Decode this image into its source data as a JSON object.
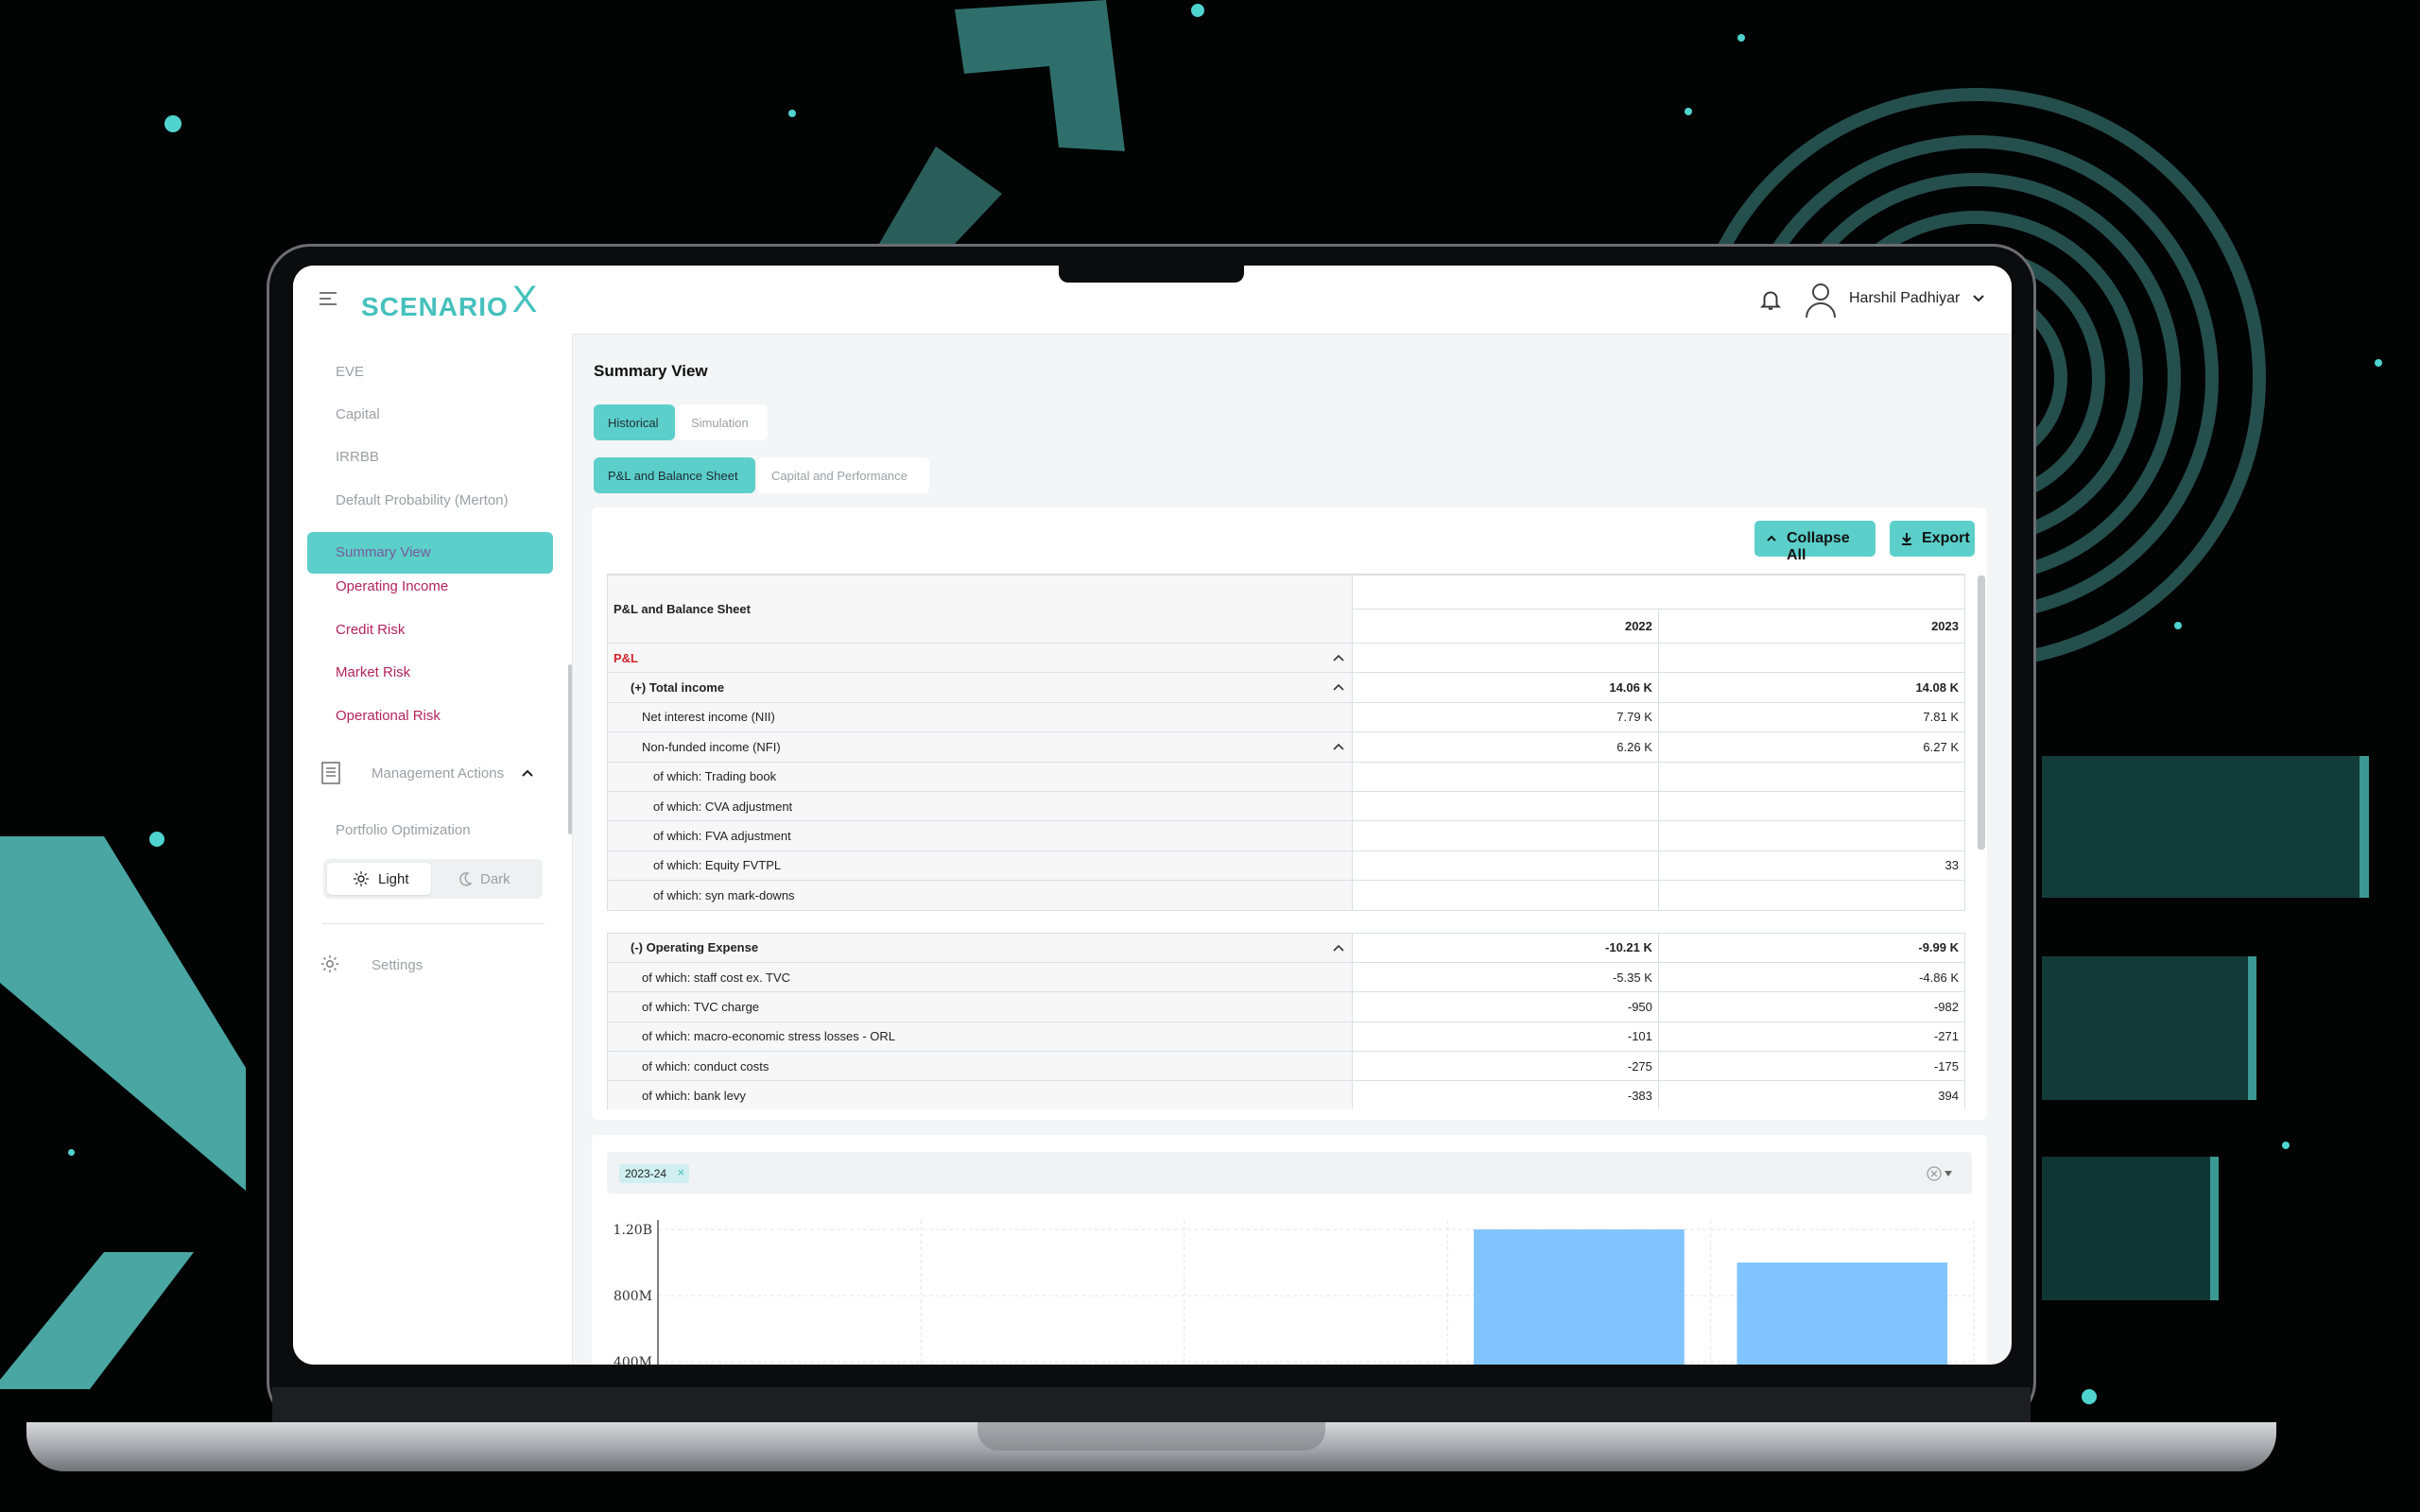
{
  "colors": {
    "accent": "#5ccfca",
    "pink": "#b3245c",
    "red": "#d2232a",
    "bar": "#82c4ff"
  },
  "app": {
    "logo": "SCENARIO",
    "logo_mark": "X",
    "user_name": "Harshil Padhiyar"
  },
  "sidebar": {
    "items": [
      {
        "label": "EVE"
      },
      {
        "label": "Capital"
      },
      {
        "label": "IRRBB"
      },
      {
        "label": "Default Probability (Merton)"
      },
      {
        "label": "Summary View",
        "active": true
      },
      {
        "label": "Operating Income"
      },
      {
        "label": "Credit Risk"
      },
      {
        "label": "Market Risk"
      },
      {
        "label": "Operational Risk"
      }
    ],
    "management_label": "Management Actions",
    "portfolio_label": "Portfolio Optimization",
    "theme_light": "Light",
    "theme_dark": "Dark",
    "settings_label": "Settings"
  },
  "main": {
    "title": "Summary View",
    "tabs": [
      "Historical",
      "Simulation"
    ],
    "subtabs": [
      "P&L and Balance Sheet",
      "Capital and Performance"
    ],
    "collapse_label": "Collapse All",
    "export_label": "Export"
  },
  "table": {
    "header": "P&L and Balance Sheet",
    "years": [
      "2022",
      "2023"
    ],
    "rows": [
      {
        "label": "P&L",
        "v2022": "",
        "v2023": ""
      },
      {
        "label": "(+) Total income",
        "v2022": "14.06 K",
        "v2023": "14.08 K"
      },
      {
        "label": "Net interest income (NII)",
        "v2022": "7.79 K",
        "v2023": "7.81 K"
      },
      {
        "label": "Non-funded income (NFI)",
        "v2022": "6.26 K",
        "v2023": "6.27 K"
      },
      {
        "label": "of which: Trading book",
        "v2022": "",
        "v2023": ""
      },
      {
        "label": "of which: CVA adjustment",
        "v2022": "",
        "v2023": ""
      },
      {
        "label": "of which: FVA adjustment",
        "v2022": "",
        "v2023": ""
      },
      {
        "label": "of which: Equity FVTPL",
        "v2022": "",
        "v2023": "33"
      },
      {
        "label": "of which: syn mark-downs",
        "v2022": "",
        "v2023": ""
      },
      {
        "label": "(-) Operating Expense",
        "v2022": "-10.21 K",
        "v2023": "-9.99 K"
      },
      {
        "label": "of which: staff cost ex. TVC",
        "v2022": "-5.35 K",
        "v2023": "-4.86 K"
      },
      {
        "label": "of which: TVC charge",
        "v2022": "-950",
        "v2023": "-982"
      },
      {
        "label": "of which: macro-economic stress losses - ORL",
        "v2022": "-101",
        "v2023": "-271"
      },
      {
        "label": "of which: conduct costs",
        "v2022": "-275",
        "v2023": "-175"
      },
      {
        "label": "of which: bank levy",
        "v2022": "-383",
        "v2023": "394"
      }
    ]
  },
  "filter": {
    "chip": "2023-24"
  },
  "chart_data": {
    "type": "bar",
    "ytick_labels": [
      "1.20B",
      "800M",
      "400M"
    ],
    "yticks": [
      1200000000,
      800000000,
      400000000
    ],
    "values": [
      null,
      null,
      null,
      1200000000,
      1000000000
    ]
  }
}
